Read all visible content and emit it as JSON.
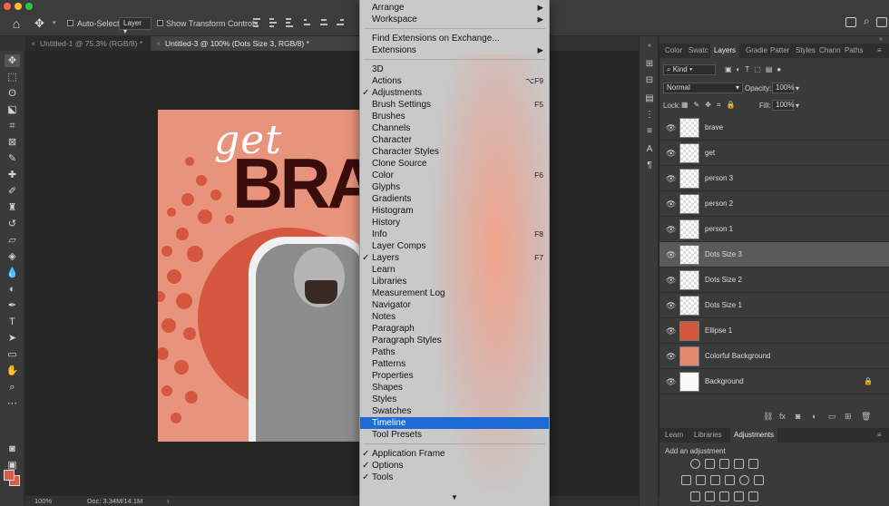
{
  "optionsbar": {
    "auto_select_label": "Auto-Select:",
    "auto_select_value": "Layer",
    "transform_controls_label": "Show Transform Controls"
  },
  "doc_tabs": [
    {
      "label": "Untitled-1 @ 75.3% (RGB/8) *"
    },
    {
      "label": "Untitled-3 @ 100% (Dots Size 3, RGB/8) *"
    }
  ],
  "artwork": {
    "top_word": "get",
    "bottom_word": "BRA"
  },
  "statusbar": {
    "zoom": "100%",
    "doc_info": "Doc: 3.34M/14.1M"
  },
  "window_menu": {
    "items": [
      {
        "label": "Arrange",
        "submenu": true
      },
      {
        "label": "Workspace",
        "submenu": true
      },
      {
        "label": "Find Extensions on Exchange..."
      },
      {
        "label": "Extensions",
        "submenu": true
      },
      {
        "label": "3D"
      },
      {
        "label": "Actions",
        "shortcut": "⌥F9"
      },
      {
        "label": "Adjustments",
        "checked": true
      },
      {
        "label": "Brush Settings",
        "shortcut": "F5"
      },
      {
        "label": "Brushes"
      },
      {
        "label": "Channels"
      },
      {
        "label": "Character"
      },
      {
        "label": "Character Styles"
      },
      {
        "label": "Clone Source"
      },
      {
        "label": "Color",
        "shortcut": "F6"
      },
      {
        "label": "Glyphs"
      },
      {
        "label": "Gradients"
      },
      {
        "label": "Histogram"
      },
      {
        "label": "History"
      },
      {
        "label": "Info",
        "shortcut": "F8"
      },
      {
        "label": "Layer Comps"
      },
      {
        "label": "Layers",
        "checked": true,
        "shortcut": "F7"
      },
      {
        "label": "Learn"
      },
      {
        "label": "Libraries"
      },
      {
        "label": "Measurement Log"
      },
      {
        "label": "Navigator"
      },
      {
        "label": "Notes"
      },
      {
        "label": "Paragraph"
      },
      {
        "label": "Paragraph Styles"
      },
      {
        "label": "Paths"
      },
      {
        "label": "Patterns"
      },
      {
        "label": "Properties"
      },
      {
        "label": "Shapes"
      },
      {
        "label": "Styles"
      },
      {
        "label": "Swatches"
      },
      {
        "label": "Timeline",
        "highlighted": true
      },
      {
        "label": "Tool Presets"
      },
      {
        "label": "Application Frame",
        "checked": true
      },
      {
        "label": "Options",
        "checked": true
      },
      {
        "label": "Tools",
        "checked": true
      }
    ]
  },
  "panel": {
    "tabs": [
      "Color",
      "Swatc",
      "Layers",
      "Gradie",
      "Patter",
      "Styles",
      "Chann",
      "Paths"
    ],
    "active_tab": "Layers",
    "filter_kind": "Kind",
    "blend_mode": "Normal",
    "opacity_label": "Opacity:",
    "opacity_value": "100%",
    "lock_label": "Lock:",
    "fill_label": "Fill:",
    "fill_value": "100%",
    "layers": [
      {
        "name": "brave"
      },
      {
        "name": "get"
      },
      {
        "name": "person 3"
      },
      {
        "name": "person 2"
      },
      {
        "name": "person 1"
      },
      {
        "name": "Dots Size 3",
        "selected": true
      },
      {
        "name": "Dots Size 2"
      },
      {
        "name": "Dots Size 1"
      },
      {
        "name": "Ellipse 1"
      },
      {
        "name": "Colorful Background"
      },
      {
        "name": "Background",
        "locked": true
      }
    ],
    "bottom_tabs": [
      "Learn",
      "Libraries",
      "Adjustments"
    ],
    "bottom_active": "Adjustments",
    "add_adjustment": "Add an adjustment"
  },
  "colors": {
    "accent_highlight": "#1f6bd6",
    "artwork_orange": "#d6573f",
    "artwork_peach": "#e8947c"
  }
}
